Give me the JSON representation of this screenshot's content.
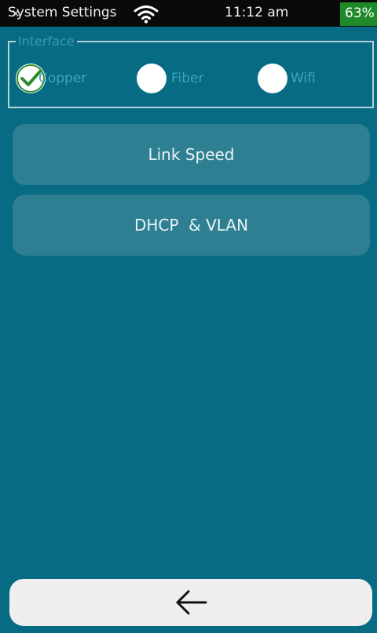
{
  "status_bar": {
    "title": "System Settings",
    "close_glyph": "✕",
    "wifi_icon": "wifi-icon",
    "time": "11:12 am",
    "battery": "63%",
    "battery_color": "#1f8a2a"
  },
  "interface": {
    "legend": "Interface",
    "options": [
      {
        "label": "Copper",
        "selected": true
      },
      {
        "label": "Fiber",
        "selected": false
      },
      {
        "label": "Wifi",
        "selected": false
      }
    ]
  },
  "menu": {
    "link_speed": "Link Speed",
    "dhcp_vlan": "DHCP  & VLAN"
  },
  "footer": {
    "back_icon": "back-arrow-icon"
  },
  "colors": {
    "background": "#066b83",
    "button": "#2f7f93",
    "check": "#2e8b2e"
  }
}
